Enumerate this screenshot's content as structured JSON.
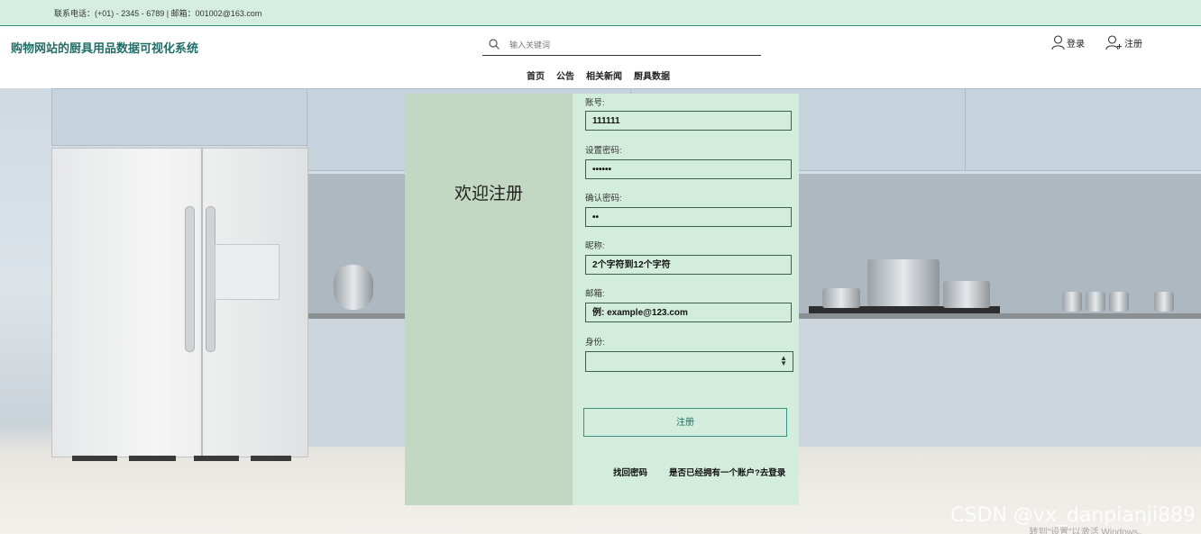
{
  "topbar": {
    "contact": "联系电话：(+01) - 2345 - 6789 | 邮箱：001002@163.com"
  },
  "header": {
    "site_title": "购物网站的厨具用品数据可视化系统",
    "search_placeholder": "输入关键词",
    "login_label": "登录",
    "register_label": "注册"
  },
  "nav": [
    "首页",
    "公告",
    "相关新闻",
    "厨具数据"
  ],
  "form": {
    "welcome": "欢迎注册",
    "account_label": "账号:",
    "account_value": "111111",
    "password_label": "设置密码:",
    "password_value": "••••••",
    "confirm_label": "确认密码:",
    "confirm_value": "••",
    "nickname_label": "昵称:",
    "nickname_placeholder": "2个字符到12个字符",
    "email_label": "邮箱:",
    "email_placeholder": "例: example@123.com",
    "identity_label": "身份:",
    "identity_value": "",
    "submit_label": "注册",
    "forgot_label": "找回密码",
    "have_account_label": "是否已经拥有一个账户?去登录"
  },
  "watermark": "CSDN @vx_danpianji889",
  "os_watermark": "转到\"设置\"以激活 Windows。",
  "colors": {
    "accent": "#1f6f68",
    "panel_left": "#c2d8c3",
    "panel_right": "#d3eddd",
    "topbar": "#d6eee2"
  }
}
